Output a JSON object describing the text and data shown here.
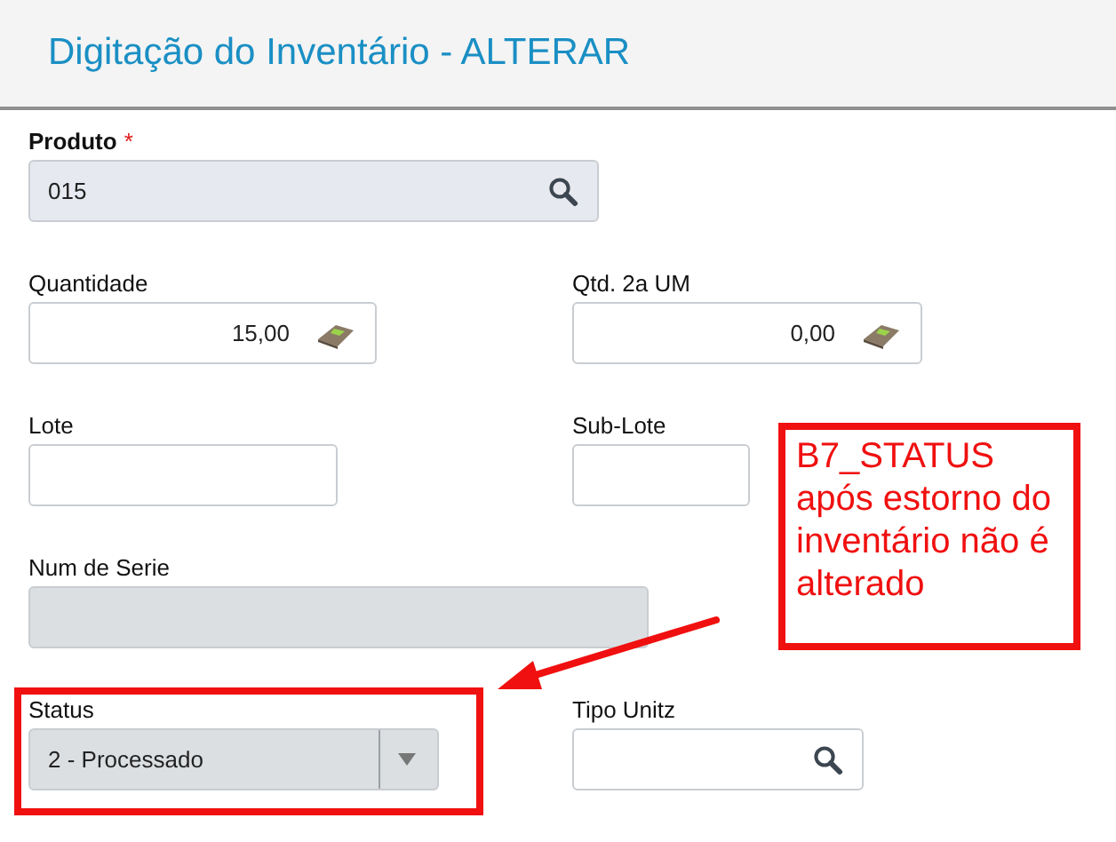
{
  "header": {
    "title": "Digitação do Inventário - ALTERAR"
  },
  "rows": [
    [
      {
        "kind": "lookup",
        "label": "Produto",
        "required": true,
        "value": "015",
        "disabled": true
      }
    ],
    [
      {
        "kind": "number",
        "label": "Quantidade",
        "required": false,
        "value": "15,00",
        "disabled": false
      },
      {
        "kind": "number",
        "label": "Qtd. 2a UM",
        "required": false,
        "value": "0,00",
        "disabled": false
      }
    ],
    [
      {
        "kind": "text",
        "label": "Lote",
        "required": false,
        "disabled": false
      },
      {
        "kind": "text",
        "label": "Sub-Lote",
        "required": false,
        "disabled": false
      }
    ],
    [
      {
        "kind": "text",
        "label": "Num de Serie",
        "required": false,
        "disabled": true
      }
    ],
    [
      {
        "kind": "select",
        "label": "Status",
        "required": false,
        "value": "2 - Processado",
        "disabled": true
      },
      {
        "kind": "lookup",
        "label": "Tipo Unitz",
        "required": false,
        "disabled": false
      }
    ]
  ],
  "required_symbol": "*",
  "annotation": {
    "text": "B7_STATUS após estorno do inventário não é alterado"
  }
}
